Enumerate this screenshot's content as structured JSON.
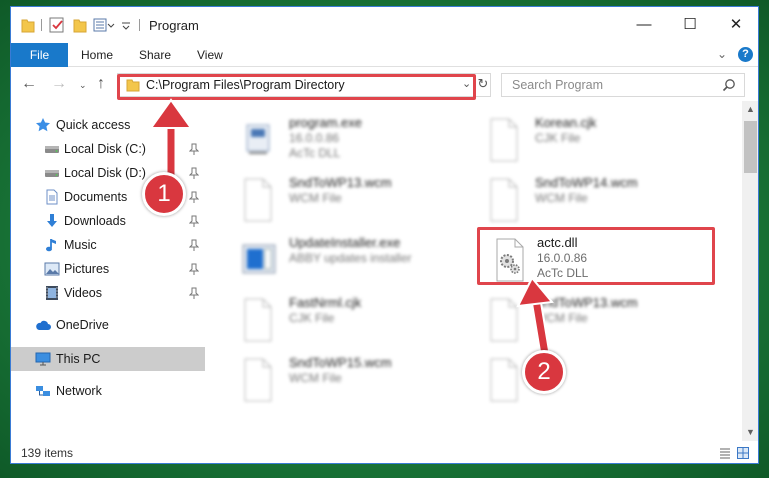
{
  "window": {
    "title": "Program",
    "controls": {
      "minimize": "—",
      "maximize": "☐",
      "close": "✕"
    }
  },
  "ribbon": {
    "tabs": [
      "File",
      "Home",
      "Share",
      "View"
    ],
    "collapse_glyph": "⌄",
    "help_glyph": "?"
  },
  "address": {
    "path": "C:\\Program Files\\Program Directory",
    "dropdown_glyph": "⌄",
    "refresh_glyph": "↻"
  },
  "nav_buttons": {
    "back": "←",
    "forward": "→",
    "recent": "⌄",
    "up": "↑"
  },
  "search": {
    "placeholder": "Search Program",
    "icon": "search-icon"
  },
  "sidebar": {
    "items": [
      {
        "label": "Quick access",
        "icon": "star-icon",
        "pinned": false
      },
      {
        "label": "Local Disk (C:)",
        "icon": "drive-icon",
        "pinned": true
      },
      {
        "label": "Local Disk (D:)",
        "icon": "drive-icon",
        "pinned": true
      },
      {
        "label": "Documents",
        "icon": "documents-icon",
        "pinned": true
      },
      {
        "label": "Downloads",
        "icon": "download-icon",
        "pinned": true
      },
      {
        "label": "Music",
        "icon": "music-icon",
        "pinned": true
      },
      {
        "label": "Pictures",
        "icon": "pictures-icon",
        "pinned": true
      },
      {
        "label": "Videos",
        "icon": "videos-icon",
        "pinned": true
      },
      {
        "label": "OneDrive",
        "icon": "cloud-icon",
        "pinned": false
      },
      {
        "label": "This PC",
        "icon": "pc-icon",
        "pinned": false,
        "selected": true
      },
      {
        "label": "Network",
        "icon": "network-icon",
        "pinned": false
      }
    ]
  },
  "files": [
    {
      "name": "program.exe",
      "line2": "16.0.0.86",
      "line3": "AcTc DLL",
      "icon": "exe-icon",
      "blurred": true
    },
    {
      "name": "Korean.cjk",
      "line2": "CJK File",
      "line3": "",
      "icon": "file-icon",
      "blurred": true
    },
    {
      "name": "SndToWP13.wcm",
      "line2": "WCM File",
      "line3": "",
      "icon": "file-icon",
      "blurred": true
    },
    {
      "name": "SndToWP14.wcm",
      "line2": "WCM File",
      "line3": "",
      "icon": "file-icon",
      "blurred": true
    },
    {
      "name": "UpdateInstaller.exe",
      "line2": "ABBY updates installer",
      "line3": "",
      "icon": "installer-icon",
      "blurred": true
    },
    {
      "name": "actc.dll",
      "line2": "16.0.0.86",
      "line3": "AcTc DLL",
      "icon": "dll-gear-icon",
      "blurred": false
    },
    {
      "name": "FastNrml.cjk",
      "line2": "CJK File",
      "line3": "",
      "icon": "file-icon",
      "blurred": true
    },
    {
      "name": "SndToWP13.wcm",
      "line2": "WCM File",
      "line3": "",
      "icon": "file-icon",
      "blurred": true
    },
    {
      "name": "SndToWP15.wcm",
      "line2": "WCM File",
      "line3": "",
      "icon": "file-icon",
      "blurred": true
    },
    {
      "name": "",
      "line2": "",
      "line3": "",
      "icon": "file-icon",
      "blurred": true
    }
  ],
  "status": {
    "item_count": "139 items"
  },
  "callouts": [
    {
      "number": "1",
      "target": "address-bar"
    },
    {
      "number": "2",
      "target": "actc-dll-file"
    }
  ],
  "colors": {
    "accent": "#1979ca",
    "highlight": "#e0454c",
    "background": "#1b7a3a",
    "selection": "#cccccc"
  }
}
